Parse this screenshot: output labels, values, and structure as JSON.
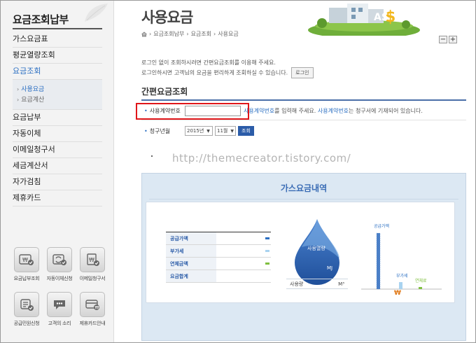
{
  "sidebar": {
    "title": "요금조회납부",
    "menu_top": [
      {
        "label": "가스요금표"
      },
      {
        "label": "평균열량조회"
      },
      {
        "label": "요금조회",
        "active": true
      }
    ],
    "submenu": [
      {
        "label": "사용요금",
        "active": true
      },
      {
        "label": "요금계산"
      }
    ],
    "menu_bottom": [
      {
        "label": "요금납부"
      },
      {
        "label": "자동이체"
      },
      {
        "label": "이메일청구서"
      },
      {
        "label": "세금계산서"
      },
      {
        "label": "자가검침"
      },
      {
        "label": "제휴카드"
      }
    ],
    "quick_links": [
      {
        "label": "요금납부조회",
        "icon": "won-check-icon"
      },
      {
        "label": "자동이체신청",
        "icon": "auto-transfer-icon"
      },
      {
        "label": "이메일청구서",
        "icon": "email-bill-icon"
      },
      {
        "label": "공급민원신청",
        "icon": "document-check-icon"
      },
      {
        "label": "고객의 소리",
        "icon": "speech-bubble-icon"
      },
      {
        "label": "제휴카드안내",
        "icon": "card-won-icon"
      }
    ]
  },
  "header": {
    "title": "사용요금",
    "breadcrumb": [
      "요금조회납부",
      "요금조회",
      "사용요금"
    ],
    "zoom_out": "−",
    "zoom_in": "+"
  },
  "notice": {
    "line1": "로그인 없이 조회하시려면 간편요금조회를 이용해 주세요.",
    "line2": "로그인하시면 고객님의 요금을 편리하게 조회하실 수 있습니다.",
    "login_label": "로그인"
  },
  "simple_inquiry": {
    "title": "간편요금조회",
    "account_label": "사용계약번호",
    "account_value": "",
    "help_link1": "사용계약번호",
    "help_text1": "를 입력해 주세요.",
    "help_link2": "사용계약번호",
    "help_text2": "는 청구서에 기재되어 있습니다.",
    "period_label": "청구년월",
    "year_value": "2015년",
    "month_value": "11월",
    "search_label": "조회"
  },
  "watermark": "http://themecreator.tistory.com/",
  "gas_panel": {
    "title": "가스요금내역",
    "fees": [
      {
        "label": "공급가액",
        "color": "#2b6fc2"
      },
      {
        "label": "부가세",
        "color": "#a9d3f0"
      },
      {
        "label": "연체금액",
        "color": "#7fbf3f"
      },
      {
        "label": "요금합계",
        "color": ""
      }
    ],
    "drop": {
      "label": "사용열량",
      "unit": "MJ"
    },
    "usage": {
      "label": "사용량",
      "unit": "M³"
    },
    "chart": {
      "labels": [
        "공급가액",
        "부가세",
        "연체료"
      ],
      "currency_symbol": "₩"
    }
  }
}
